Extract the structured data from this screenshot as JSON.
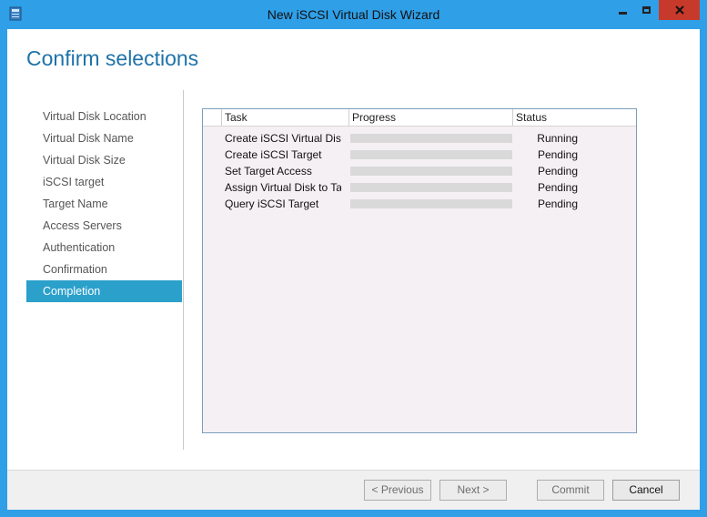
{
  "window": {
    "title": "New iSCSI Virtual Disk Wizard",
    "accent_color": "#2f9fe8",
    "close_color": "#c7392b",
    "icons": [
      "app-icon",
      "minimize-icon",
      "maximize-icon",
      "close-icon"
    ]
  },
  "page": {
    "heading": "Confirm selections"
  },
  "nav": {
    "items": [
      {
        "label": "Virtual Disk Location",
        "active": false
      },
      {
        "label": "Virtual Disk Name",
        "active": false
      },
      {
        "label": "Virtual Disk Size",
        "active": false
      },
      {
        "label": "iSCSI target",
        "active": false
      },
      {
        "label": "Target Name",
        "active": false
      },
      {
        "label": "Access Servers",
        "active": false
      },
      {
        "label": "Authentication",
        "active": false
      },
      {
        "label": "Confirmation",
        "active": false
      },
      {
        "label": "Completion",
        "active": true
      }
    ],
    "active_color": "#2ba0cb"
  },
  "tasks": {
    "columns": {
      "task": "Task",
      "progress": "Progress",
      "status": "Status"
    },
    "rows": [
      {
        "task": "Create iSCSI Virtual Disk",
        "progress": 0,
        "status": "Running"
      },
      {
        "task": "Create iSCSI Target",
        "progress": 0,
        "status": "Pending"
      },
      {
        "task": "Set Target Access",
        "progress": 0,
        "status": "Pending"
      },
      {
        "task": "Assign Virtual Disk to Target",
        "progress": 0,
        "status": "Pending"
      },
      {
        "task": "Query iSCSI Target",
        "progress": 0,
        "status": "Pending"
      }
    ]
  },
  "buttons": {
    "previous": "< Previous",
    "next": "Next >",
    "commit": "Commit",
    "cancel": "Cancel"
  }
}
